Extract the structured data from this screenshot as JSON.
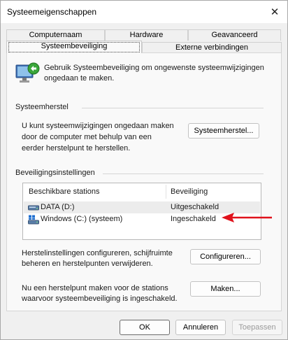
{
  "window": {
    "title": "Systeemeigenschappen",
    "close_glyph": "✕"
  },
  "tabs": {
    "row_back": [
      "Computernaam",
      "Hardware",
      "Geavanceerd"
    ],
    "row_front": [
      "Systeembeveiliging",
      "Externe verbindingen"
    ],
    "active": "Systeembeveiliging"
  },
  "intro": {
    "text_line1": "Gebruik Systeembeveiliging om ongewenste systeemwijzigingen",
    "text_line2": "ongedaan te maken."
  },
  "restore": {
    "heading": "Systeemherstel",
    "desc_line1": "U kunt systeemwijzigingen ongedaan maken",
    "desc_line2": "door de computer met behulp van een",
    "desc_line3": "eerder herstelpunt te herstellen.",
    "button": "Systeemherstel..."
  },
  "protection": {
    "heading": "Beveiligingsinstellingen",
    "columns": [
      "Beschikbare stations",
      "Beveiliging"
    ],
    "rows": [
      {
        "drive": "DATA (D:)",
        "status": "Uitgeschakeld",
        "icon": "drive-icon"
      },
      {
        "drive": "Windows (C:) (systeem)",
        "status": "Ingeschakeld",
        "icon": "system-drive-icon"
      }
    ],
    "arrow_color": "#e0121c"
  },
  "configure": {
    "desc_line1": "Herstelinstellingen configureren, schijfruimte",
    "desc_line2": "beheren en herstelpunten verwijderen.",
    "button": "Configureren..."
  },
  "create": {
    "desc_line1": "Nu een herstelpunt maken voor de stations",
    "desc_line2": "waarvoor systeembeveiliging is ingeschakeld.",
    "button": "Maken..."
  },
  "footer": {
    "ok": "OK",
    "cancel": "Annuleren",
    "apply": "Toepassen"
  }
}
